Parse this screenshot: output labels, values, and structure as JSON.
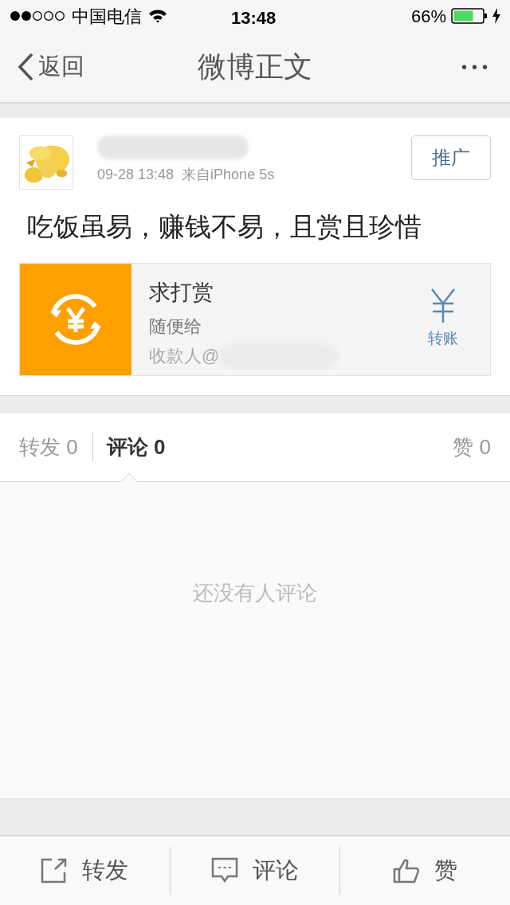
{
  "status_bar": {
    "carrier": "中国电信",
    "time": "13:48",
    "battery": "66%"
  },
  "nav": {
    "back": "返回",
    "title": "微博正文",
    "more": "•••"
  },
  "post": {
    "time": "09-28 13:48",
    "source": "来自iPhone 5s",
    "promote": "推广",
    "text": "吃饭虽易，赚钱不易，且赏且珍惜",
    "reward": {
      "title": "求打赏",
      "subtitle": "随便给",
      "payee": "收款人@",
      "action": "转账"
    }
  },
  "tabs": [
    {
      "label": "转发",
      "count": "0",
      "selected": false
    },
    {
      "label": "评论",
      "count": "0",
      "selected": true
    },
    {
      "label": "赞",
      "count": "0",
      "selected": false
    }
  ],
  "empty_text": "还没有人评论",
  "toolbar": [
    {
      "kind": "share",
      "label": "转发"
    },
    {
      "kind": "comment",
      "label": "评论"
    },
    {
      "kind": "like",
      "label": "赞"
    }
  ]
}
